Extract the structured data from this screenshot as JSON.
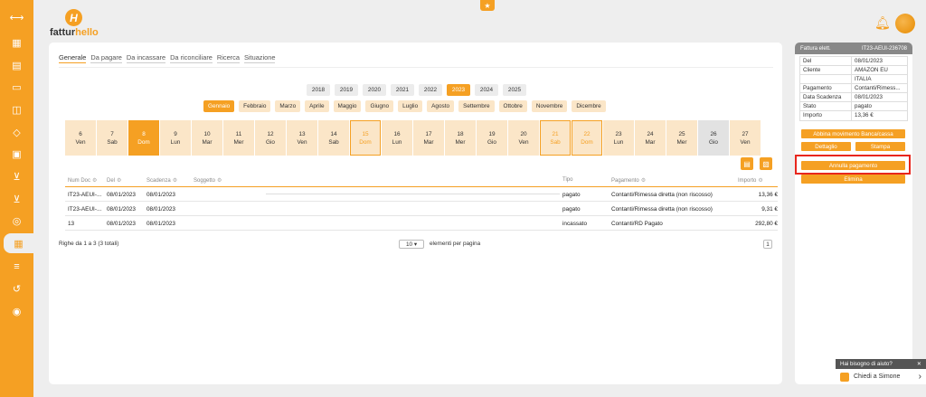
{
  "app": {
    "logo_prefix": "fattur",
    "logo_suffix": "hello",
    "logo_mark": "H"
  },
  "sidebar": {
    "icons": [
      "expand-icon",
      "dashboard-icon",
      "invoice-icon",
      "archive-icon",
      "contacts-icon",
      "tag-icon",
      "register-icon",
      "cart-icon",
      "cart-add-icon",
      "globe-icon",
      "calendar-payments-icon",
      "settings-sliders-icon",
      "history-icon",
      "piggy-bank-icon"
    ],
    "active_index": 10
  },
  "tabs": [
    "Generale",
    "Da pagare",
    "Da incassare",
    "Da riconciliare",
    "Ricerca",
    "Situazione"
  ],
  "years": [
    "2018",
    "2019",
    "2020",
    "2021",
    "2022",
    "2023",
    "2024",
    "2025"
  ],
  "active_year": "2023",
  "months": [
    "Gennaio",
    "Febbraio",
    "Marzo",
    "Aprile",
    "Maggio",
    "Giugno",
    "Luglio",
    "Agosto",
    "Settembre",
    "Ottobre",
    "Novembre",
    "Dicembre"
  ],
  "active_month": "Gennaio",
  "days": [
    {
      "num": "6",
      "dow": "Ven",
      "state": ""
    },
    {
      "num": "7",
      "dow": "Sab",
      "state": ""
    },
    {
      "num": "8",
      "dow": "Dom",
      "state": "active"
    },
    {
      "num": "9",
      "dow": "Lun",
      "state": ""
    },
    {
      "num": "10",
      "dow": "Mar",
      "state": ""
    },
    {
      "num": "11",
      "dow": "Mer",
      "state": ""
    },
    {
      "num": "12",
      "dow": "Gio",
      "state": ""
    },
    {
      "num": "13",
      "dow": "Ven",
      "state": ""
    },
    {
      "num": "14",
      "dow": "Sab",
      "state": ""
    },
    {
      "num": "15",
      "dow": "Dom",
      "state": "outlined"
    },
    {
      "num": "16",
      "dow": "Lun",
      "state": ""
    },
    {
      "num": "17",
      "dow": "Mar",
      "state": ""
    },
    {
      "num": "18",
      "dow": "Mer",
      "state": ""
    },
    {
      "num": "19",
      "dow": "Gio",
      "state": ""
    },
    {
      "num": "20",
      "dow": "Ven",
      "state": ""
    },
    {
      "num": "21",
      "dow": "Sab",
      "state": "outlined"
    },
    {
      "num": "22",
      "dow": "Dom",
      "state": "outlined"
    },
    {
      "num": "23",
      "dow": "Lun",
      "state": ""
    },
    {
      "num": "24",
      "dow": "Mar",
      "state": ""
    },
    {
      "num": "25",
      "dow": "Mer",
      "state": ""
    },
    {
      "num": "26",
      "dow": "Gio",
      "state": "grey"
    },
    {
      "num": "27",
      "dow": "Ven",
      "state": ""
    }
  ],
  "table": {
    "headers": {
      "num_doc": "Num Doc",
      "del": "Del",
      "scadenza": "Scadenza",
      "soggetto": "Soggetto",
      "tipo": "Tipo",
      "pagamento": "Pagamento",
      "importo": "Importo"
    },
    "rows": [
      {
        "num_doc": "IT23-AEUI-...",
        "del": "08/01/2023",
        "scadenza": "08/01/2023",
        "tipo": "pagato",
        "pagamento": "Contanti/Rimessa diretta (non riscosso)",
        "importo": "13,36 €"
      },
      {
        "num_doc": "IT23-AEUI-...",
        "del": "08/01/2023",
        "scadenza": "08/01/2023",
        "tipo": "pagato",
        "pagamento": "Contanti/Rimessa diretta (non riscosso)",
        "importo": "9,31 €"
      },
      {
        "num_doc": "13",
        "del": "08/01/2023",
        "scadenza": "08/01/2023",
        "tipo": "incassato",
        "pagamento": "Contanti/RD Pagato",
        "importo": "292,80 €"
      }
    ]
  },
  "footer": {
    "rows_info": "Righe da 1 a 3 (3 totali)",
    "per_page": "10",
    "per_page_label": "elementi per pagina",
    "page": "1"
  },
  "detail": {
    "header_label": "Fattura elett.",
    "header_value": "IT23-AEUI-236708",
    "fields": [
      {
        "k": "Del",
        "v": "08/01/2023"
      },
      {
        "k": "Cliente",
        "v": "AMAZON EU"
      },
      {
        "k": "",
        "v": "ITALIA"
      },
      {
        "k": "Pagamento",
        "v": "Contanti/Rimess..."
      },
      {
        "k": "Data Scadenza",
        "v": "08/01/2023"
      },
      {
        "k": "Stato",
        "v": "pagato"
      },
      {
        "k": "Importo",
        "v": "13,36 €"
      }
    ],
    "buttons": {
      "abbina": "Abbina movimento Banca/cassa",
      "dettaglio": "Dettaglio",
      "stampa": "Stampa",
      "annulla": "Annulla pagamento",
      "elimina": "Elimina"
    }
  },
  "help": {
    "question": "Hai bisogno di aiuto?",
    "close": "✕",
    "agent": "Chiedi a Simone",
    "arrow": "›"
  },
  "colors": {
    "accent": "#f5a023",
    "accent_light": "#fbe6c8",
    "highlight": "#e8261d"
  }
}
